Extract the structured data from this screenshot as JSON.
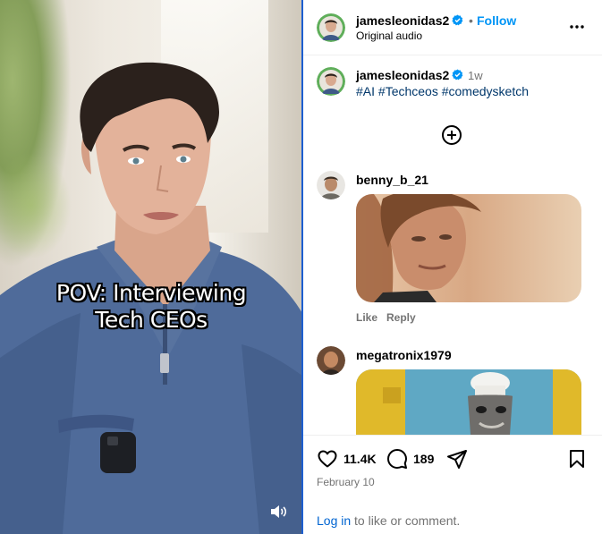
{
  "video": {
    "caption_line1": "POV: Interviewing",
    "caption_line2": "Tech CEOs",
    "icon": "speaker-volume-icon"
  },
  "header": {
    "username": "jamesleonidas2",
    "separator": "•",
    "follow_label": "Follow",
    "subtitle": "Original audio",
    "more_icon": "more-options-icon"
  },
  "post_caption": {
    "username": "jamesleonidas2",
    "time": "1w",
    "hashtags": "#AI #Techceos #comedysketch"
  },
  "load_more_icon": "plus-circle-icon",
  "comments": [
    {
      "username": "benny_b_21",
      "like_label": "Like",
      "reply_label": "Reply"
    },
    {
      "username": "megatronix1979"
    }
  ],
  "footer": {
    "likes": "11.4K",
    "comments": "189",
    "date": "February 10",
    "login_link": "Log in",
    "login_text": " to like or comment."
  },
  "colors": {
    "accent": "#0095f6",
    "link": "#00376b",
    "verified": "#0095f6",
    "muted": "#737373"
  }
}
